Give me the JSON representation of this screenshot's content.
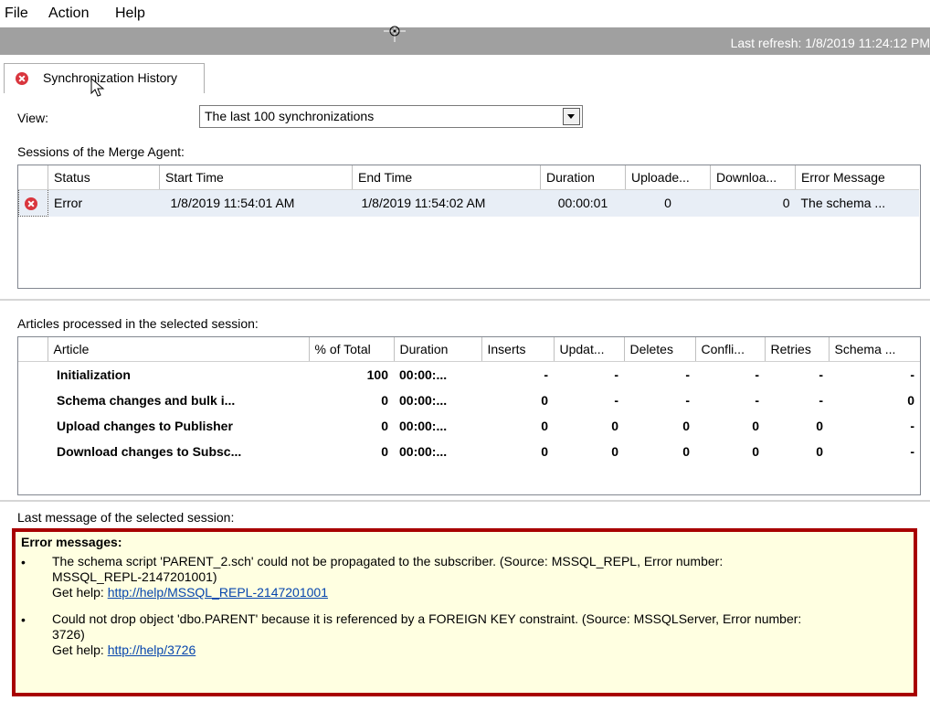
{
  "menu": [
    "File",
    "Action",
    "Help"
  ],
  "status": {
    "last_refresh": "Last refresh: 1/8/2019 11:24:12 PM"
  },
  "tab": {
    "label": "Synchronization History"
  },
  "view": {
    "label": "View:",
    "selected": "The last 100 synchronizations"
  },
  "sessions": {
    "label": "Sessions of the Merge Agent:",
    "columns": [
      "Status",
      "Start Time",
      "End Time",
      "Duration",
      "Uploade...",
      "Downloa...",
      "Error Message"
    ],
    "rows": [
      {
        "status": "Error",
        "start": "1/8/2019 11:54:01 AM",
        "end": "1/8/2019 11:54:02 AM",
        "duration": "00:00:01",
        "uploaded": "0",
        "downloaded": "0",
        "error": "The schema ..."
      }
    ]
  },
  "articles": {
    "label": "Articles processed in the selected session:",
    "columns": [
      "Article",
      "% of Total",
      "Duration",
      "Inserts",
      "Updat...",
      "Deletes",
      "Confli...",
      "Retries",
      "Schema ..."
    ],
    "rows": [
      [
        "Initialization",
        "100",
        "00:00:...",
        "-",
        "-",
        "-",
        "-",
        "-",
        "-"
      ],
      [
        "Schema changes and bulk i...",
        "0",
        "00:00:...",
        "0",
        "-",
        "-",
        "-",
        "-",
        "0"
      ],
      [
        "Upload changes to Publisher",
        "0",
        "00:00:...",
        "0",
        "0",
        "0",
        "0",
        "0",
        "-"
      ],
      [
        "Download changes to Subsc...",
        "0",
        "00:00:...",
        "0",
        "0",
        "0",
        "0",
        "0",
        "-"
      ]
    ]
  },
  "last_message": {
    "label": "Last message of the selected session:",
    "title": "Error messages:",
    "items": [
      {
        "text1": "The schema script 'PARENT_2.sch' could not be propagated to the subscriber. (Source: MSSQL_REPL, Error number:",
        "text2": "MSSQL_REPL-2147201001)",
        "help_prefix": "Get help: ",
        "help_link": "http://help/MSSQL_REPL-2147201001"
      },
      {
        "text1": "Could not drop object 'dbo.PARENT' because it is referenced by a FOREIGN KEY constraint. (Source: MSSQLServer, Error number:",
        "text2": "3726)",
        "help_prefix": "Get help: ",
        "help_link": "http://help/3726"
      }
    ]
  },
  "colors": {
    "accent_error": "#d9363e",
    "msg_border": "#a80000",
    "msg_background": "#ffffe1",
    "link": "#0645ad"
  }
}
